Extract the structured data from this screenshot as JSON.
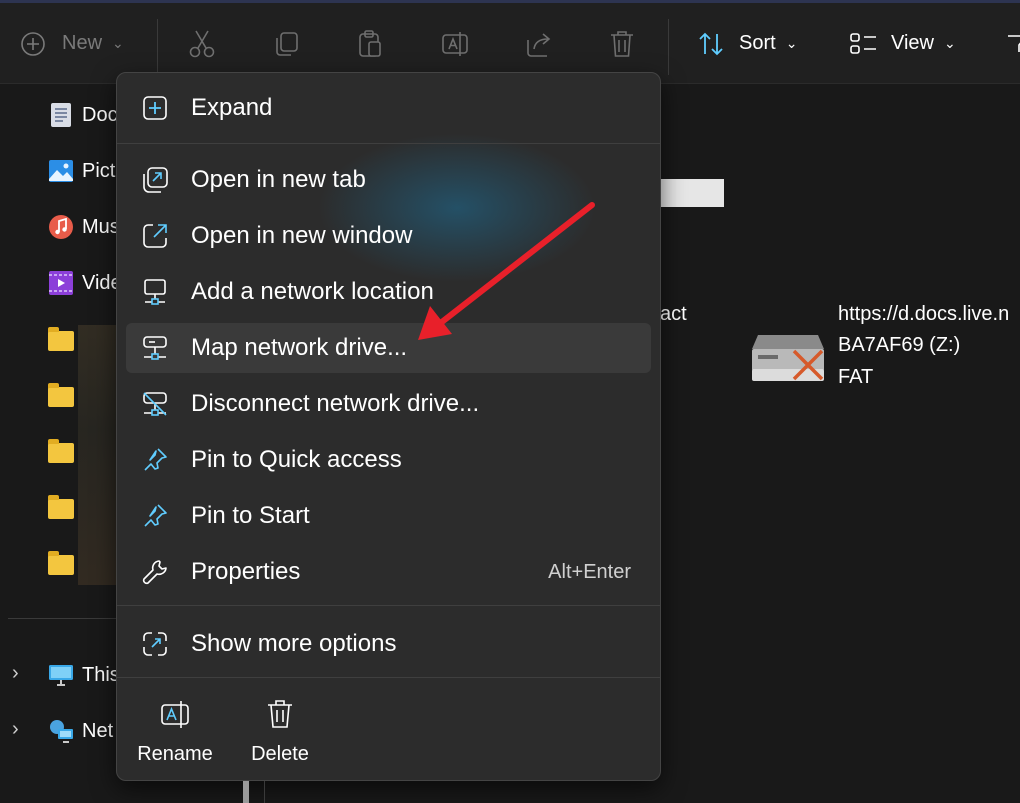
{
  "toolbar": {
    "new_label": "New",
    "sort_label": "Sort",
    "view_label": "View"
  },
  "sidebar": {
    "items": [
      {
        "label": "Doc",
        "icon": "documents-icon"
      },
      {
        "label": "Pict",
        "icon": "pictures-icon"
      },
      {
        "label": "Mus",
        "icon": "music-icon"
      },
      {
        "label": "Vide",
        "icon": "videos-icon"
      }
    ],
    "tree": [
      {
        "label": "This",
        "icon": "this-pc-icon"
      },
      {
        "label": "Net",
        "icon": "network-icon"
      }
    ]
  },
  "main": {
    "partial_text": "act",
    "drive": {
      "line1": "https://d.docs.live.n",
      "line2": "BA7AF69 (Z:)",
      "line3": "FAT"
    }
  },
  "context_menu": {
    "items": [
      {
        "label": "Expand",
        "icon": "expand-icon"
      },
      {
        "label": "Open in new tab",
        "icon": "new-tab-icon"
      },
      {
        "label": "Open in new window",
        "icon": "new-window-icon"
      },
      {
        "label": "Add a network location",
        "icon": "network-location-icon"
      },
      {
        "label": "Map network drive...",
        "icon": "map-drive-icon"
      },
      {
        "label": "Disconnect network drive...",
        "icon": "disconnect-drive-icon"
      },
      {
        "label": "Pin to Quick access",
        "icon": "pin-icon"
      },
      {
        "label": "Pin to Start",
        "icon": "pin-icon"
      },
      {
        "label": "Properties",
        "icon": "wrench-icon",
        "shortcut": "Alt+Enter"
      },
      {
        "label": "Show more options",
        "icon": "more-options-icon"
      }
    ],
    "bottom": [
      {
        "label": "Rename",
        "icon": "rename-icon"
      },
      {
        "label": "Delete",
        "icon": "delete-icon"
      }
    ]
  },
  "colors": {
    "annotation_arrow": "#e8202a",
    "menu_background": "#2c2c2c",
    "accent_icon": "#60cdff"
  }
}
